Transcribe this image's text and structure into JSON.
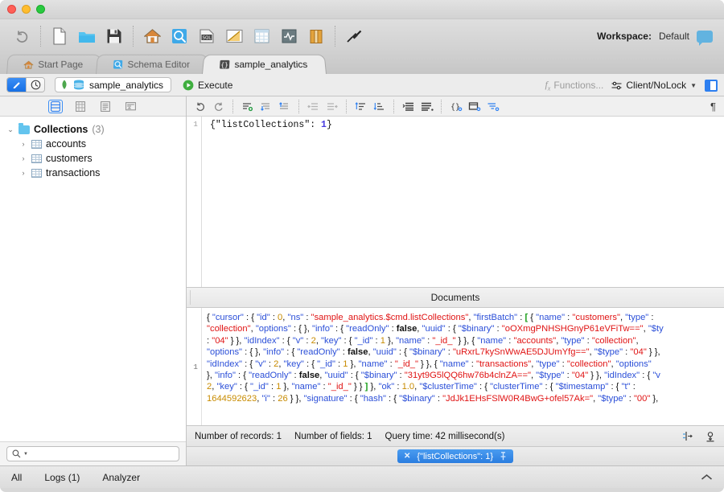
{
  "window": {
    "traffic_lights": [
      "close",
      "minimize",
      "zoom"
    ]
  },
  "toolbar": {
    "buttons": [
      {
        "name": "undo",
        "icon": "undo-arrow-icon",
        "label": "Undo"
      },
      {
        "name": "new-file",
        "icon": "new-document-icon",
        "label": "New"
      },
      {
        "name": "open-folder",
        "icon": "open-folder-icon",
        "label": "Open"
      },
      {
        "name": "save",
        "icon": "floppy-save-icon",
        "label": "Save"
      },
      {
        "name": "home",
        "icon": "home-icon",
        "label": "Start Page"
      },
      {
        "name": "schema",
        "icon": "schema-magnifier-icon",
        "label": "Schema Editor"
      },
      {
        "name": "sql",
        "icon": "sql-document-icon",
        "label": "SQL Query"
      },
      {
        "name": "aggregate",
        "icon": "aggregate-ruler-icon",
        "label": "Aggregate"
      },
      {
        "name": "table",
        "icon": "table-grid-icon",
        "label": "Table View"
      },
      {
        "name": "monitor",
        "icon": "monitor-pulse-icon",
        "label": "Monitoring"
      },
      {
        "name": "books",
        "icon": "books-icon",
        "label": "Reference"
      },
      {
        "name": "connect",
        "icon": "plug-connect-icon",
        "label": "Connect"
      }
    ],
    "workspace_label": "Workspace:",
    "workspace_value": "Default",
    "chat_icon": "chat-bubble-icon"
  },
  "tabs": [
    {
      "label": "Start Page",
      "icon": "home-icon",
      "active": false
    },
    {
      "label": "Schema Editor",
      "icon": "schema-magnifier-icon",
      "active": false
    },
    {
      "label": "sample_analytics",
      "icon": "braces-icon",
      "active": true
    }
  ],
  "querybar": {
    "mode_edit_icon": "pencil-icon",
    "mode_history_icon": "clock-icon",
    "leaf_icon": "mongodb-leaf-icon",
    "db_icon": "database-icon",
    "db_name": "sample_analytics",
    "execute_icon": "play-icon",
    "execute_label": "Execute",
    "functions_label": "Functions...",
    "functions_icon": "fx-icon",
    "client_lock_label": "Client/NoLock",
    "client_lock_icon": "sliders-icon",
    "dropdown_icon": "chevron-down-icon",
    "panel_toggle_icon": "side-panel-icon"
  },
  "sidebar": {
    "toolbar_icons": [
      {
        "name": "collections-view",
        "icon": "database-list-icon",
        "selected": true
      },
      {
        "name": "grid-view",
        "icon": "grid-icon",
        "selected": false
      },
      {
        "name": "document-view",
        "icon": "document-lines-icon",
        "selected": false
      },
      {
        "name": "card-view",
        "icon": "card-icon",
        "selected": false
      }
    ],
    "tree": {
      "root": {
        "label": "Collections",
        "count": "(3)",
        "icon": "folder-icon",
        "expanded": true
      },
      "children": [
        {
          "label": "accounts",
          "icon": "collection-icon"
        },
        {
          "label": "customers",
          "icon": "collection-icon"
        },
        {
          "label": "transactions",
          "icon": "collection-icon"
        }
      ]
    },
    "search": {
      "placeholder": "",
      "icon": "search-magnifier-icon",
      "value": ""
    }
  },
  "editor": {
    "toolbar_icons": [
      {
        "name": "undo",
        "icon": "undo-icon"
      },
      {
        "name": "redo",
        "icon": "redo-icon"
      },
      {
        "name": "add-line",
        "icon": "add-line-icon"
      },
      {
        "name": "move-down",
        "icon": "move-down-icon"
      },
      {
        "name": "move-up",
        "icon": "move-up-icon"
      },
      {
        "name": "outdent",
        "icon": "outdent-icon"
      },
      {
        "name": "indent",
        "icon": "indent-icon"
      },
      {
        "name": "sort-asc",
        "icon": "sort-asc-icon"
      },
      {
        "name": "sort-desc",
        "icon": "sort-desc-icon"
      },
      {
        "name": "align-right",
        "icon": "align-right-icon"
      },
      {
        "name": "align-left",
        "icon": "align-left-icon"
      },
      {
        "name": "add-object",
        "icon": "braces-add-icon"
      },
      {
        "name": "add-field",
        "icon": "field-add-icon"
      },
      {
        "name": "add-list",
        "icon": "list-add-icon"
      }
    ],
    "pilcrow_icon": "pilcrow-icon",
    "line_number": "1",
    "code_prefix": "{\"listCollections\": ",
    "code_number": "1",
    "code_suffix": "}"
  },
  "results": {
    "header": "Documents",
    "row_number": "1",
    "lines": [
      [
        {
          "t": "{ ",
          "c": "jp"
        },
        {
          "t": "\"cursor\"",
          "c": "jk"
        },
        {
          "t": " : { ",
          "c": "jp"
        },
        {
          "t": "\"id\"",
          "c": "jk"
        },
        {
          "t": " : ",
          "c": "jp"
        },
        {
          "t": "0",
          "c": "jn"
        },
        {
          "t": ", ",
          "c": "jp"
        },
        {
          "t": "\"ns\"",
          "c": "jk"
        },
        {
          "t": " : ",
          "c": "jp"
        },
        {
          "t": "\"sample_analytics.$cmd.listCollections\"",
          "c": "js"
        },
        {
          "t": ", ",
          "c": "jp"
        },
        {
          "t": "\"firstBatch\"",
          "c": "jk"
        },
        {
          "t": " : ",
          "c": "jp"
        },
        {
          "t": "[",
          "c": "jbr"
        },
        {
          "t": " { ",
          "c": "jp"
        },
        {
          "t": "\"name\"",
          "c": "jk"
        },
        {
          "t": " : ",
          "c": "jp"
        },
        {
          "t": "\"customers\"",
          "c": "js"
        },
        {
          "t": ", ",
          "c": "jp"
        },
        {
          "t": "\"type\"",
          "c": "jk"
        },
        {
          "t": " : ",
          "c": "jp"
        }
      ],
      [
        {
          "t": "\"collection\"",
          "c": "js"
        },
        {
          "t": ", ",
          "c": "jp"
        },
        {
          "t": "\"options\"",
          "c": "jk"
        },
        {
          "t": " : { }, ",
          "c": "jp"
        },
        {
          "t": "\"info\"",
          "c": "jk"
        },
        {
          "t": " : { ",
          "c": "jp"
        },
        {
          "t": "\"readOnly\"",
          "c": "jk"
        },
        {
          "t": " : ",
          "c": "jp"
        },
        {
          "t": "false",
          "c": "jb"
        },
        {
          "t": ", ",
          "c": "jp"
        },
        {
          "t": "\"uuid\"",
          "c": "jk"
        },
        {
          "t": " : { ",
          "c": "jp"
        },
        {
          "t": "\"$binary\"",
          "c": "jk"
        },
        {
          "t": " : ",
          "c": "jp"
        },
        {
          "t": "\"oOXmgPNHSHGnyP61eVFiTw==\"",
          "c": "js"
        },
        {
          "t": ", ",
          "c": "jp"
        },
        {
          "t": "\"$ty",
          "c": "jk"
        }
      ],
      [
        {
          "t": " : ",
          "c": "jp"
        },
        {
          "t": "\"04\"",
          "c": "js"
        },
        {
          "t": " } }, ",
          "c": "jp"
        },
        {
          "t": "\"idIndex\"",
          "c": "jk"
        },
        {
          "t": " : { ",
          "c": "jp"
        },
        {
          "t": "\"v\"",
          "c": "jk"
        },
        {
          "t": " : ",
          "c": "jp"
        },
        {
          "t": "2",
          "c": "jn"
        },
        {
          "t": ", ",
          "c": "jp"
        },
        {
          "t": "\"key\"",
          "c": "jk"
        },
        {
          "t": " : { ",
          "c": "jp"
        },
        {
          "t": "\"_id\"",
          "c": "jk"
        },
        {
          "t": " : ",
          "c": "jp"
        },
        {
          "t": "1",
          "c": "jn"
        },
        {
          "t": " }, ",
          "c": "jp"
        },
        {
          "t": "\"name\"",
          "c": "jk"
        },
        {
          "t": " : ",
          "c": "jp"
        },
        {
          "t": "\"_id_\"",
          "c": "js"
        },
        {
          "t": " } }, { ",
          "c": "jp"
        },
        {
          "t": "\"name\"",
          "c": "jk"
        },
        {
          "t": " : ",
          "c": "jp"
        },
        {
          "t": "\"accounts\"",
          "c": "js"
        },
        {
          "t": ", ",
          "c": "jp"
        },
        {
          "t": "\"type\"",
          "c": "jk"
        },
        {
          "t": " : ",
          "c": "jp"
        },
        {
          "t": "\"collection\"",
          "c": "js"
        },
        {
          "t": ",",
          "c": "jp"
        }
      ],
      [
        {
          "t": "\"options\"",
          "c": "jk"
        },
        {
          "t": " : { }, ",
          "c": "jp"
        },
        {
          "t": "\"info\"",
          "c": "jk"
        },
        {
          "t": " : { ",
          "c": "jp"
        },
        {
          "t": "\"readOnly\"",
          "c": "jk"
        },
        {
          "t": " : ",
          "c": "jp"
        },
        {
          "t": "false",
          "c": "jb"
        },
        {
          "t": ", ",
          "c": "jp"
        },
        {
          "t": "\"uuid\"",
          "c": "jk"
        },
        {
          "t": " : { ",
          "c": "jp"
        },
        {
          "t": "\"$binary\"",
          "c": "jk"
        },
        {
          "t": " : ",
          "c": "jp"
        },
        {
          "t": "\"uRxrL7kySnWwAE5DJUmYfg==\"",
          "c": "js"
        },
        {
          "t": ", ",
          "c": "jp"
        },
        {
          "t": "\"$type\"",
          "c": "jk"
        },
        {
          "t": " : ",
          "c": "jp"
        },
        {
          "t": "\"04\"",
          "c": "js"
        },
        {
          "t": " } },",
          "c": "jp"
        }
      ],
      [
        {
          "t": "\"idIndex\"",
          "c": "jk"
        },
        {
          "t": " : { ",
          "c": "jp"
        },
        {
          "t": "\"v\"",
          "c": "jk"
        },
        {
          "t": " : ",
          "c": "jp"
        },
        {
          "t": "2",
          "c": "jn"
        },
        {
          "t": ", ",
          "c": "jp"
        },
        {
          "t": "\"key\"",
          "c": "jk"
        },
        {
          "t": " : { ",
          "c": "jp"
        },
        {
          "t": "\"_id\"",
          "c": "jk"
        },
        {
          "t": " : ",
          "c": "jp"
        },
        {
          "t": "1",
          "c": "jn"
        },
        {
          "t": " }, ",
          "c": "jp"
        },
        {
          "t": "\"name\"",
          "c": "jk"
        },
        {
          "t": " : ",
          "c": "jp"
        },
        {
          "t": "\"_id_\"",
          "c": "js"
        },
        {
          "t": " } }, { ",
          "c": "jp"
        },
        {
          "t": "\"name\"",
          "c": "jk"
        },
        {
          "t": " : ",
          "c": "jp"
        },
        {
          "t": "\"transactions\"",
          "c": "js"
        },
        {
          "t": ", ",
          "c": "jp"
        },
        {
          "t": "\"type\"",
          "c": "jk"
        },
        {
          "t": " : ",
          "c": "jp"
        },
        {
          "t": "\"collection\"",
          "c": "js"
        },
        {
          "t": ", ",
          "c": "jp"
        },
        {
          "t": "\"options\"",
          "c": "jk"
        }
      ],
      [
        {
          "t": "}, ",
          "c": "jp"
        },
        {
          "t": "\"info\"",
          "c": "jk"
        },
        {
          "t": " : { ",
          "c": "jp"
        },
        {
          "t": "\"readOnly\"",
          "c": "jk"
        },
        {
          "t": " : ",
          "c": "jp"
        },
        {
          "t": "false",
          "c": "jb"
        },
        {
          "t": ", ",
          "c": "jp"
        },
        {
          "t": "\"uuid\"",
          "c": "jk"
        },
        {
          "t": " : { ",
          "c": "jp"
        },
        {
          "t": "\"$binary\"",
          "c": "jk"
        },
        {
          "t": " : ",
          "c": "jp"
        },
        {
          "t": "\"31yt9G5lQQ6hw76b4clnZA==\"",
          "c": "js"
        },
        {
          "t": ", ",
          "c": "jp"
        },
        {
          "t": "\"$type\"",
          "c": "jk"
        },
        {
          "t": " : ",
          "c": "jp"
        },
        {
          "t": "\"04\"",
          "c": "js"
        },
        {
          "t": " } }, ",
          "c": "jp"
        },
        {
          "t": "\"idIndex\"",
          "c": "jk"
        },
        {
          "t": " : { ",
          "c": "jp"
        },
        {
          "t": "\"v",
          "c": "jk"
        }
      ],
      [
        {
          "t": "2",
          "c": "jn"
        },
        {
          "t": ", ",
          "c": "jp"
        },
        {
          "t": "\"key\"",
          "c": "jk"
        },
        {
          "t": " : { ",
          "c": "jp"
        },
        {
          "t": "\"_id\"",
          "c": "jk"
        },
        {
          "t": " : ",
          "c": "jp"
        },
        {
          "t": "1",
          "c": "jn"
        },
        {
          "t": " }, ",
          "c": "jp"
        },
        {
          "t": "\"name\"",
          "c": "jk"
        },
        {
          "t": " : ",
          "c": "jp"
        },
        {
          "t": "\"_id_\"",
          "c": "js"
        },
        {
          "t": " } } ",
          "c": "jp"
        },
        {
          "t": "]",
          "c": "jbr"
        },
        {
          "t": " }, ",
          "c": "jp"
        },
        {
          "t": "\"ok\"",
          "c": "jk"
        },
        {
          "t": " : ",
          "c": "jp"
        },
        {
          "t": "1.0",
          "c": "jn"
        },
        {
          "t": ", ",
          "c": "jp"
        },
        {
          "t": "\"$clusterTime\"",
          "c": "jk"
        },
        {
          "t": " : { ",
          "c": "jp"
        },
        {
          "t": "\"clusterTime\"",
          "c": "jk"
        },
        {
          "t": " : { ",
          "c": "jp"
        },
        {
          "t": "\"$timestamp\"",
          "c": "jk"
        },
        {
          "t": " : { ",
          "c": "jp"
        },
        {
          "t": "\"t\"",
          "c": "jk"
        },
        {
          "t": " :",
          "c": "jp"
        }
      ],
      [
        {
          "t": "1644592623",
          "c": "jn"
        },
        {
          "t": ", ",
          "c": "jp"
        },
        {
          "t": "\"i\"",
          "c": "jk"
        },
        {
          "t": " : ",
          "c": "jp"
        },
        {
          "t": "26",
          "c": "jn"
        },
        {
          "t": " } }, ",
          "c": "jp"
        },
        {
          "t": "\"signature\"",
          "c": "jk"
        },
        {
          "t": " : { ",
          "c": "jp"
        },
        {
          "t": "\"hash\"",
          "c": "jk"
        },
        {
          "t": " : { ",
          "c": "jp"
        },
        {
          "t": "\"$binary\"",
          "c": "jk"
        },
        {
          "t": " : ",
          "c": "jp"
        },
        {
          "t": "\"JdJk1EHsFSlW0R4BwG+ofel57Ak=\"",
          "c": "js"
        },
        {
          "t": ", ",
          "c": "jp"
        },
        {
          "t": "\"$type\"",
          "c": "jk"
        },
        {
          "t": " : ",
          "c": "jp"
        },
        {
          "t": "\"00\"",
          "c": "js"
        },
        {
          "t": " },",
          "c": "jp"
        }
      ]
    ]
  },
  "statusbar": {
    "records_label": "Number of records: 1",
    "fields_label": "Number of fields: 1",
    "query_time_label": "Query time: 42 millisecond(s)",
    "icons": [
      {
        "name": "expand-fields",
        "icon": "expand-columns-icon"
      },
      {
        "name": "export-results",
        "icon": "export-download-icon"
      }
    ]
  },
  "run_tabs": [
    {
      "label": "{\"listCollections\": 1}",
      "close_icon": "close-x-icon",
      "pin_icon": "pin-icon",
      "active": true
    }
  ],
  "bottombar": {
    "items": [
      {
        "name": "all",
        "label": "All"
      },
      {
        "name": "logs",
        "label": "Logs (1)"
      },
      {
        "name": "analyzer",
        "label": "Analyzer"
      }
    ],
    "collapse_icon": "chevron-up-icon"
  },
  "colors": {
    "accent_blue": "#2d7ff0",
    "json_key": "#2b4fd8",
    "json_string": "#e01414",
    "json_number": "#c88b00",
    "json_bracket": "#1a9e1a",
    "tab_active_bg": "#ececec"
  }
}
